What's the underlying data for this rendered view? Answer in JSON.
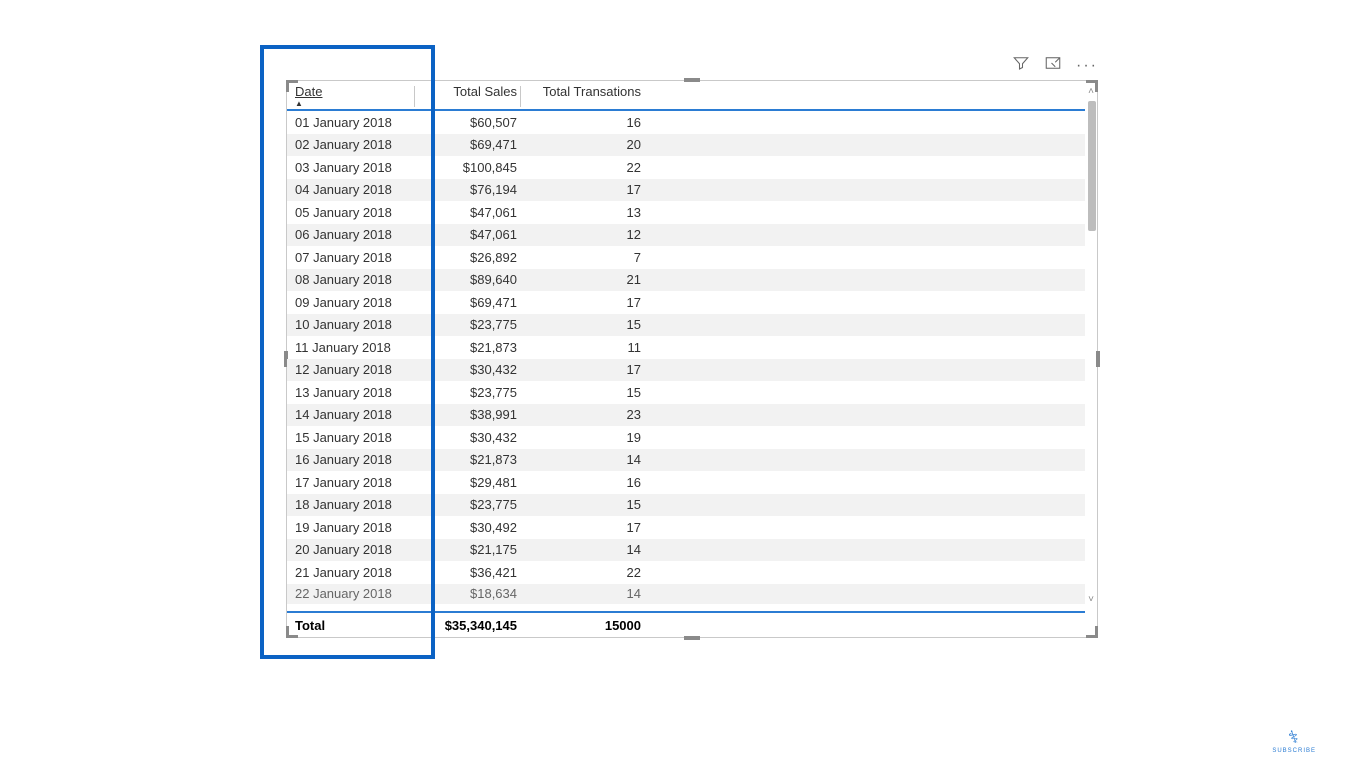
{
  "table": {
    "headers": {
      "date": "Date",
      "sales": "Total Sales",
      "transactions": "Total Transations"
    },
    "rows": [
      {
        "date": "01 January 2018",
        "sales": "$60,507",
        "trans": "16"
      },
      {
        "date": "02 January 2018",
        "sales": "$69,471",
        "trans": "20"
      },
      {
        "date": "03 January 2018",
        "sales": "$100,845",
        "trans": "22"
      },
      {
        "date": "04 January 2018",
        "sales": "$76,194",
        "trans": "17"
      },
      {
        "date": "05 January 2018",
        "sales": "$47,061",
        "trans": "13"
      },
      {
        "date": "06 January 2018",
        "sales": "$47,061",
        "trans": "12"
      },
      {
        "date": "07 January 2018",
        "sales": "$26,892",
        "trans": "7"
      },
      {
        "date": "08 January 2018",
        "sales": "$89,640",
        "trans": "21"
      },
      {
        "date": "09 January 2018",
        "sales": "$69,471",
        "trans": "17"
      },
      {
        "date": "10 January 2018",
        "sales": "$23,775",
        "trans": "15"
      },
      {
        "date": "11 January 2018",
        "sales": "$21,873",
        "trans": "11"
      },
      {
        "date": "12 January 2018",
        "sales": "$30,432",
        "trans": "17"
      },
      {
        "date": "13 January 2018",
        "sales": "$23,775",
        "trans": "15"
      },
      {
        "date": "14 January 2018",
        "sales": "$38,991",
        "trans": "23"
      },
      {
        "date": "15 January 2018",
        "sales": "$30,432",
        "trans": "19"
      },
      {
        "date": "16 January 2018",
        "sales": "$21,873",
        "trans": "14"
      },
      {
        "date": "17 January 2018",
        "sales": "$29,481",
        "trans": "16"
      },
      {
        "date": "18 January 2018",
        "sales": "$23,775",
        "trans": "15"
      },
      {
        "date": "19 January 2018",
        "sales": "$30,492",
        "trans": "17"
      },
      {
        "date": "20 January 2018",
        "sales": "$21,175",
        "trans": "14"
      },
      {
        "date": "21 January 2018",
        "sales": "$36,421",
        "trans": "22"
      },
      {
        "date": "22 January 2018",
        "sales": "$18,634",
        "trans": "14"
      }
    ],
    "total": {
      "label": "Total",
      "sales": "$35,340,145",
      "trans": "15000"
    },
    "sort_indicator": "▲"
  },
  "toolbar": {
    "more": "···"
  },
  "watermark": {
    "label": "SUBSCRIBE"
  }
}
